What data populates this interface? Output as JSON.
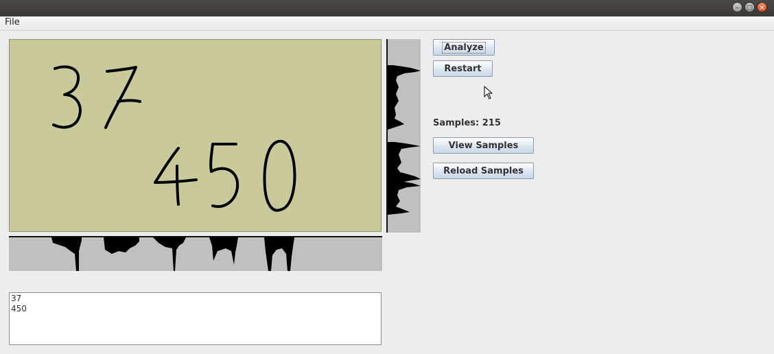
{
  "window": {
    "controls": [
      {
        "id": "minimize",
        "glyph": "–",
        "icon": "minimize-icon"
      },
      {
        "id": "maximize",
        "glyph": "□",
        "icon": "maximize-icon"
      },
      {
        "id": "close",
        "glyph": "×",
        "icon": "close-icon"
      }
    ]
  },
  "menu": {
    "file_label": "File"
  },
  "drawing": {
    "icon": "handwritten-digits-canvas",
    "background": "#c8cb99"
  },
  "controls": {
    "analyze_label": "Analyze",
    "restart_label": "Restart",
    "samples_text": "Samples: 215",
    "view_samples_label": "View Samples",
    "reload_samples_label": "Reload Samples"
  },
  "output": {
    "lines": [
      "37",
      "450"
    ]
  }
}
